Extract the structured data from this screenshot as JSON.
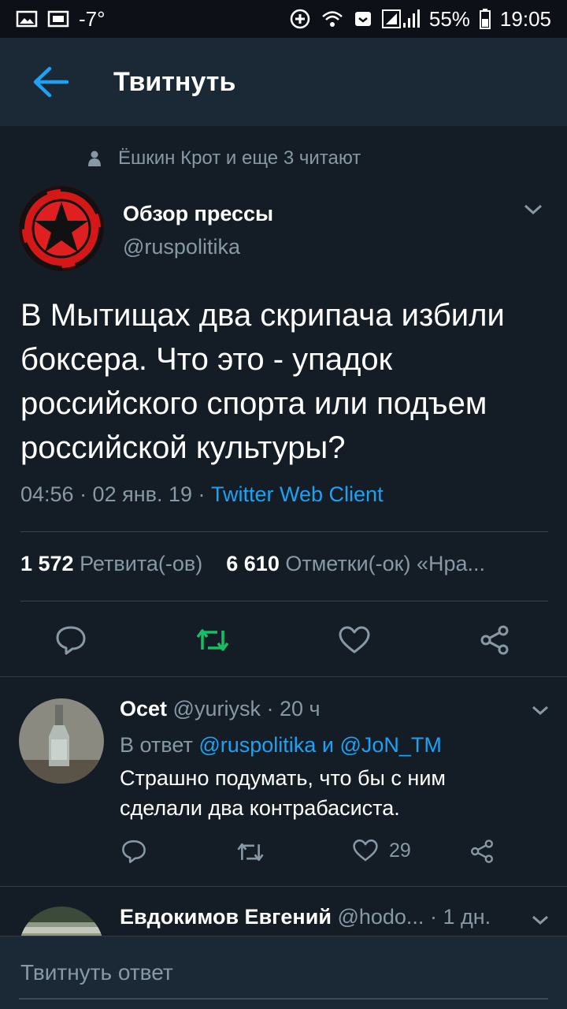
{
  "status_bar": {
    "temperature": "-7°",
    "battery": "55%",
    "time": "19:05"
  },
  "header": {
    "title": "Твитнуть"
  },
  "social_context": "Ёшкин Крот и еще 3 читают",
  "tweet": {
    "author_name": "Обзор прессы",
    "author_handle": "@ruspolitika",
    "text": "В Мытищах два скрипача избили боксера. Что это - упадок российского спорта или подъем российской культуры?",
    "timestamp": "04:56 · 02 янв. 19 · ",
    "client": "Twitter Web Client",
    "retweets_count": "1 572",
    "retweets_label": "Ретвита(-ов)",
    "likes_count": "6 610",
    "likes_label": "Отметки(-ок) «Нра..."
  },
  "replies": [
    {
      "name": "Ocet",
      "handle": "@yuriysk",
      "time": "· 20 ч",
      "reply_prefix": "В ответ",
      "reply_user1": "@ruspolitika",
      "reply_and": "и",
      "reply_user2": "@JoN_TM",
      "text": "Страшно подумать, что бы с ним сделали два контрабасиста.",
      "likes": "29"
    },
    {
      "name": "Евдокимов Евгений",
      "handle": "@hodo...",
      "time": "· 1 дн."
    }
  ],
  "compose": {
    "placeholder": "Твитнуть ответ"
  },
  "colors": {
    "background": "#141d26",
    "header": "#1b2836",
    "accent": "#1da1f2",
    "retweet_green": "#17bf63",
    "muted": "#8899a6"
  },
  "icons": [
    "back-arrow-icon",
    "person-icon",
    "chevron-down-icon",
    "reply-icon",
    "retweet-icon",
    "like-icon",
    "share-icon"
  ]
}
